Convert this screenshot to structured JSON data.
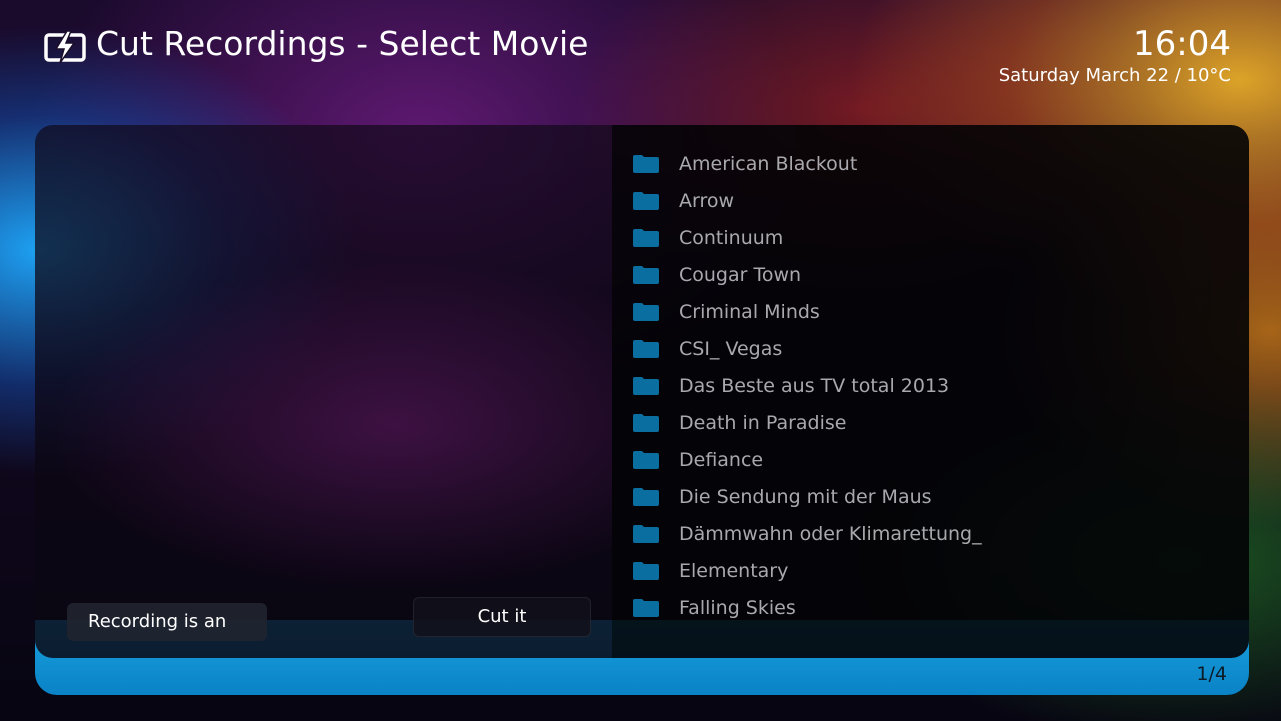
{
  "header": {
    "title": "Cut Recordings - Select Movie",
    "icon": "lightning-bolt-icon"
  },
  "clock": {
    "time": "16:04",
    "date_weather": "Saturday March 22 / 10°C"
  },
  "left_pane": {
    "recording_button_label": "Recording is an",
    "cut_button_label": "Cut it"
  },
  "movies": [
    {
      "label": "American Blackout",
      "icon": "folder-icon"
    },
    {
      "label": "Arrow",
      "icon": "folder-icon"
    },
    {
      "label": "Continuum",
      "icon": "folder-icon"
    },
    {
      "label": "Cougar Town",
      "icon": "folder-icon"
    },
    {
      "label": "Criminal Minds",
      "icon": "folder-icon"
    },
    {
      "label": "CSI_ Vegas",
      "icon": "folder-icon"
    },
    {
      "label": "Das Beste aus TV total 2013",
      "icon": "folder-icon"
    },
    {
      "label": "Death in Paradise",
      "icon": "folder-icon"
    },
    {
      "label": "Defiance",
      "icon": "folder-icon"
    },
    {
      "label": "Die Sendung mit der Maus",
      "icon": "folder-icon"
    },
    {
      "label": "Dämmwahn oder Klimarettung_",
      "icon": "folder-icon"
    },
    {
      "label": "Elementary",
      "icon": "folder-icon"
    },
    {
      "label": "Falling Skies",
      "icon": "folder-icon"
    }
  ],
  "pagination": {
    "page": "1/4"
  },
  "colors": {
    "folder": "#0a6fa0",
    "list_text": "#a9a9ad",
    "footer_accent": "#0a8fd6"
  }
}
